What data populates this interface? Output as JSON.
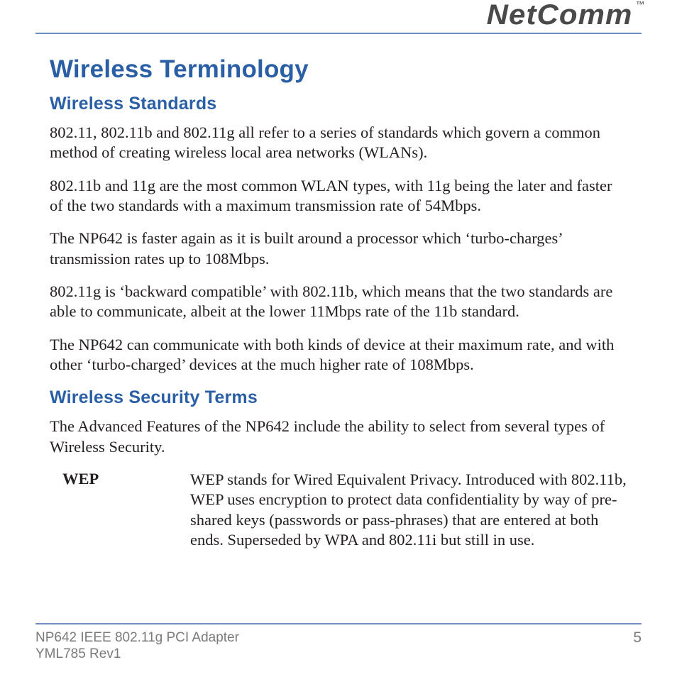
{
  "brand": {
    "name": "NetComm",
    "trademark": "™"
  },
  "title": "Wireless Terminology",
  "sections": {
    "standards": {
      "heading": "Wireless Standards",
      "p1": "802.11, 802.11b and 802.11g all refer to a series of standards which govern a common method of creating wireless local area networks (WLANs).",
      "p2": "802.11b and 11g are the most common WLAN types, with 11g being the later and faster of the two standards with a maximum transmission rate of 54Mbps.",
      "p3": "The NP642 is faster again as it is built around a processor which ‘turbo-charges’ transmission rates up to 108Mbps.",
      "p4": "802.11g is ‘backward compatible’ with 802.11b, which means that the two standards are able to communicate, albeit at the lower 11Mbps rate of the 11b standard.",
      "p5": "The NP642 can communicate with both kinds of device at their maximum rate, and with other ‘turbo-charged’ devices at the much higher rate of 108Mbps."
    },
    "security": {
      "heading": "Wireless Security Terms",
      "intro": "The Advanced Features of the NP642 include the ability to select from several types of Wireless Security.",
      "terms": [
        {
          "label": "WEP",
          "desc": "WEP stands for Wired Equivalent Privacy. Introduced with 802.11b, WEP  uses encryption to protect data confidentiality by way of pre-shared keys (passwords or pass-phrases) that are entered at both ends. Superseded by WPA and 802.11i but still in use."
        }
      ]
    }
  },
  "footer": {
    "product": "NP642 IEEE 802.11g PCI Adapter",
    "docrev": "YML785 Rev1",
    "page": "5"
  }
}
